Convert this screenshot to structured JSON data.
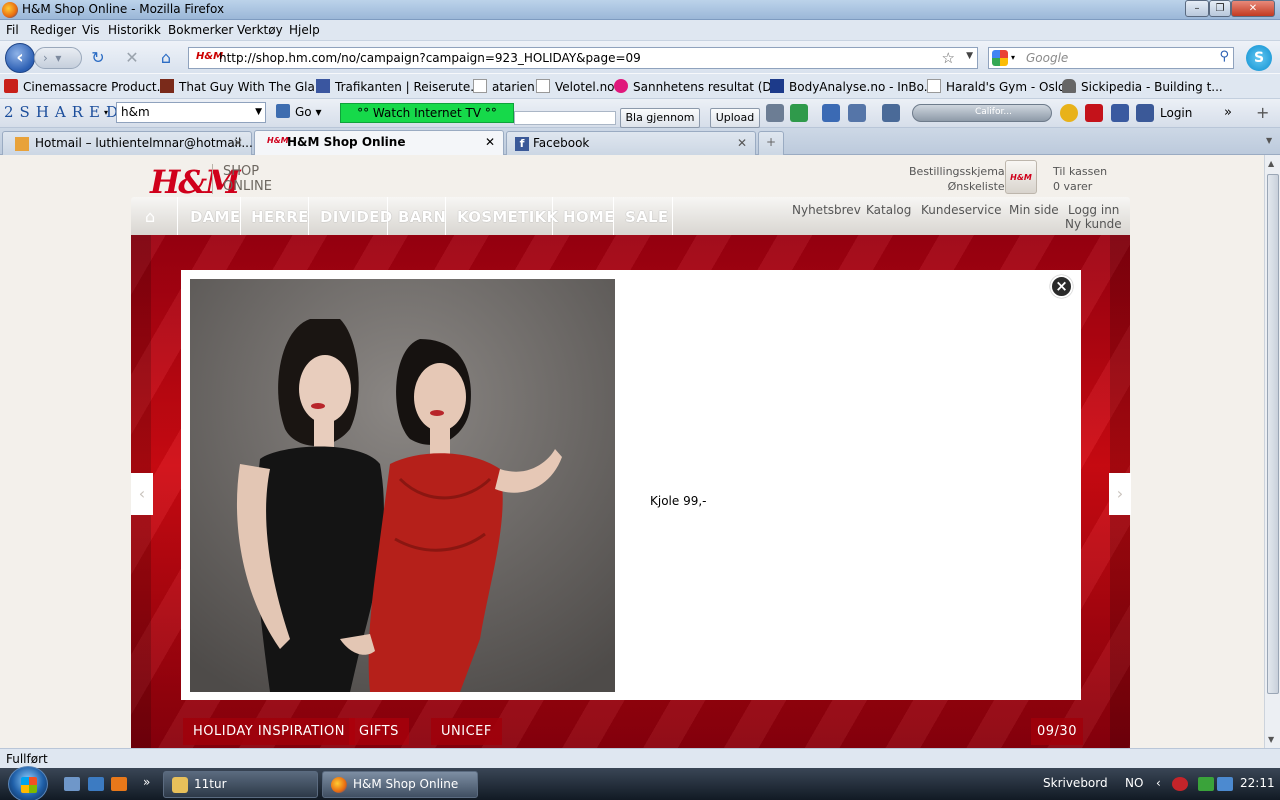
{
  "window": {
    "title": "H&M Shop Online - Mozilla Firefox"
  },
  "menu": [
    "Fil",
    "Rediger",
    "Vis",
    "Historikk",
    "Bokmerker",
    "Verktøy",
    "Hjelp"
  ],
  "nav": {
    "url": "http://shop.hm.com/no/campaign?campaign=923_HOLIDAY&page=09",
    "search_placeholder": "Google"
  },
  "bookmarks": [
    "Cinemassacre Product...",
    "That Guy With The Gla...",
    "Trafikanten | Reiserute...",
    "atarien",
    "Velotel.no",
    "Sannhetens resultat (D...",
    "BodyAnalyse.no - InBo...",
    "Harald's Gym - Oslo",
    "Sickipedia - Building t..."
  ],
  "toolbar": {
    "logo": "2SHARED",
    "search_value": "h&m",
    "go_label": "Go",
    "watch_tv": "°° Watch Internet TV °°",
    "browse_label": "Bla gjennom ...",
    "upload_label": "Upload",
    "music_label": "Califor...",
    "login_label": "Login"
  },
  "tabs": [
    {
      "label": "Hotmail – luthientelmnar@hotmail....",
      "active": false
    },
    {
      "label": "H&M Shop Online",
      "active": true
    },
    {
      "label": "Facebook",
      "active": false
    }
  ],
  "site": {
    "logo": "H&M",
    "logo_sub_1": "SHOP",
    "logo_sub_2": "ONLINE",
    "order_form": "Bestillingsskjema",
    "wishlist": "Ønskeliste",
    "checkout": "Til kassen",
    "cart_count": "0 varer",
    "bag_logo": "H&M",
    "main_nav": [
      "DAME",
      "HERRE",
      "DIVIDED",
      "BARN",
      "KOSMETIKK",
      "HOME",
      "SALE"
    ],
    "util_nav": [
      "Nyhetsbrev",
      "Katalog",
      "Kundeservice",
      "Min side",
      "Logg inn"
    ],
    "new_customer": "Ny kunde"
  },
  "modal": {
    "product_text": "Kjole 99,-"
  },
  "campaign": {
    "bottom_links": [
      "HOLIDAY INSPIRATION",
      "GIFTS",
      "UNICEF"
    ],
    "page_counter": "09/30"
  },
  "status": {
    "text": "Fullført"
  },
  "taskbar": {
    "items": [
      {
        "label": "11tur"
      },
      {
        "label": "H&M Shop Online -..."
      }
    ],
    "desktop_label": "Skrivebord",
    "lang": "NO",
    "time": "22:11"
  },
  "colors": {
    "hm_red": "#d0001b",
    "campaign_red": "#c8000f",
    "watch_tv_green": "#16d94a"
  }
}
